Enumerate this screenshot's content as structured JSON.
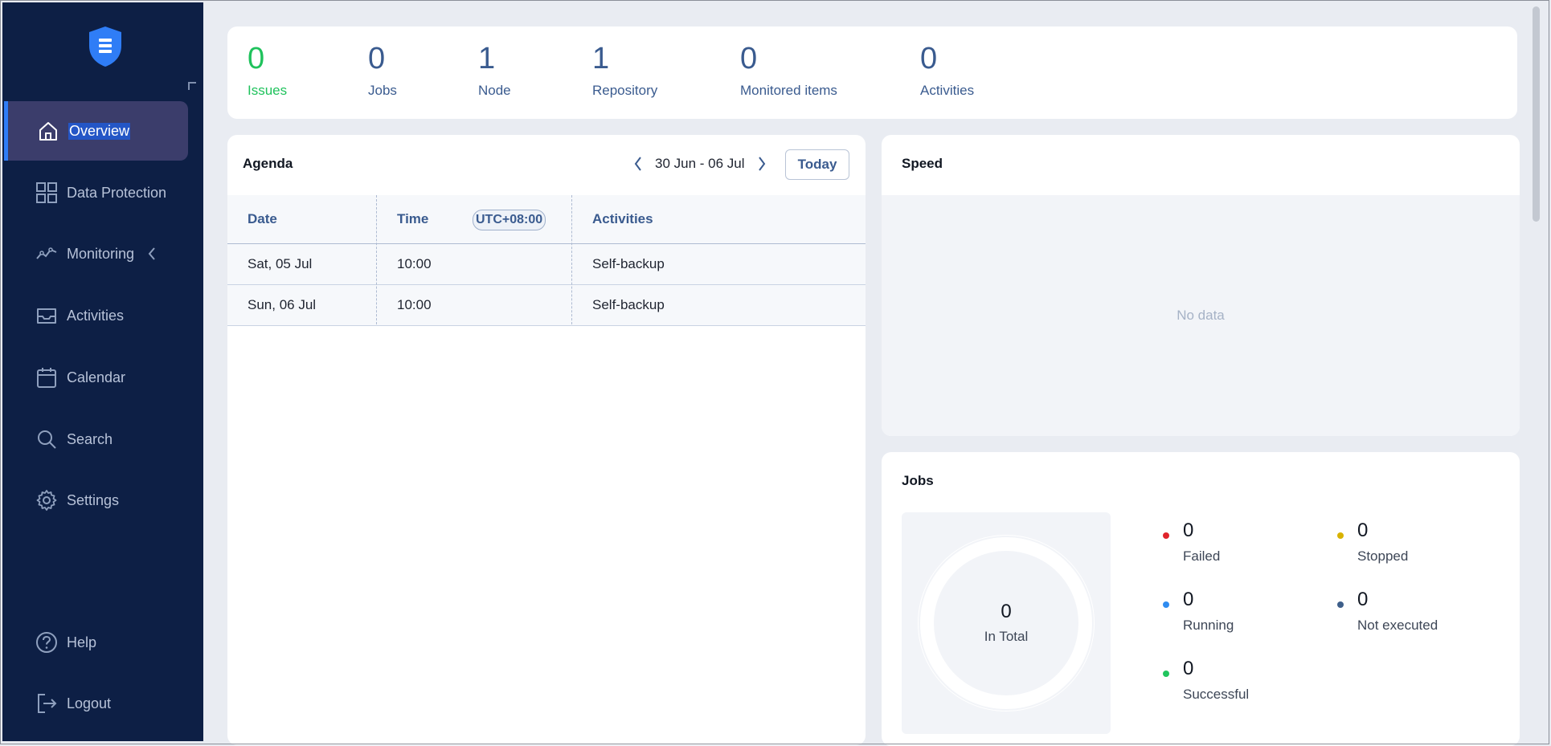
{
  "sidebar": {
    "logo": "shield-logo-icon",
    "items": [
      {
        "label": "Overview",
        "icon": "home-icon",
        "active": true
      },
      {
        "label": "Data Protection",
        "icon": "grid-icon"
      },
      {
        "label": "Monitoring",
        "icon": "activity-line-icon"
      },
      {
        "label": "Activities",
        "icon": "inbox-icon"
      },
      {
        "label": "Calendar",
        "icon": "calendar-icon"
      },
      {
        "label": "Search",
        "icon": "search-icon"
      },
      {
        "label": "Settings",
        "icon": "gear-icon"
      }
    ],
    "bottom": [
      {
        "label": "Help",
        "icon": "help-circle-icon"
      },
      {
        "label": "Logout",
        "icon": "logout-icon"
      }
    ]
  },
  "summary": {
    "issues": {
      "value": "0",
      "label": "Issues"
    },
    "jobs": {
      "value": "0",
      "label": "Jobs"
    },
    "node": {
      "value": "1",
      "label": "Node"
    },
    "repository": {
      "value": "1",
      "label": "Repository"
    },
    "monitored": {
      "value": "0",
      "label": "Monitored items"
    },
    "activities": {
      "value": "0",
      "label": "Activities"
    }
  },
  "agenda": {
    "title": "Agenda",
    "week": "30 Jun - 06 Jul",
    "today_label": "Today",
    "columns": {
      "date": "Date",
      "time": "Time",
      "timezone": "UTC+08:00",
      "activities": "Activities"
    },
    "rows": [
      {
        "date": "Sat, 05 Jul",
        "time": "10:00",
        "activity": "Self-backup"
      },
      {
        "date": "Sun, 06 Jul",
        "time": "10:00",
        "activity": "Self-backup"
      }
    ]
  },
  "speed": {
    "title": "Speed",
    "empty_text": "No data"
  },
  "jobs": {
    "title": "Jobs",
    "total": {
      "value": "0",
      "label": "In Total"
    },
    "legend": [
      {
        "value": "0",
        "label": "Failed",
        "color": "#e0242b"
      },
      {
        "value": "0",
        "label": "Stopped",
        "color": "#d8b200"
      },
      {
        "value": "0",
        "label": "Running",
        "color": "#2f8cf0"
      },
      {
        "value": "0",
        "label": "Not executed",
        "color": "#3e5f8a"
      },
      {
        "value": "0",
        "label": "Successful",
        "color": "#22c55e"
      }
    ]
  },
  "colors": {
    "sidebar": "#0d1f45",
    "accent": "#2f7df6",
    "success": "#1fc25c",
    "muted_blue": "#3a5b8f"
  }
}
